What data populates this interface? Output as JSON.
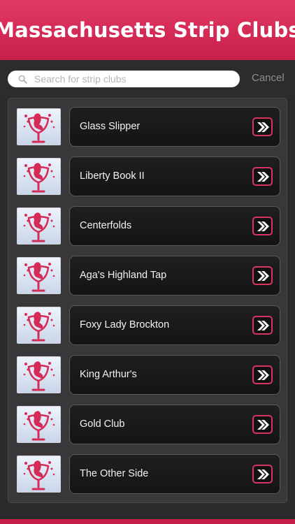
{
  "header": {
    "title": "Massachusetts Strip Clubs"
  },
  "search": {
    "placeholder": "Search for strip clubs",
    "value": "",
    "cancel_label": "Cancel"
  },
  "list": {
    "items": [
      {
        "label": "Glass Slipper"
      },
      {
        "label": "Liberty Book II"
      },
      {
        "label": "Centerfolds"
      },
      {
        "label": "Aga's Highland Tap"
      },
      {
        "label": "Foxy Lady Brockton"
      },
      {
        "label": "King Arthur's"
      },
      {
        "label": "Gold Club"
      },
      {
        "label": "The Other Side"
      }
    ]
  },
  "icons": {
    "thumbnail": "dancer-in-glass-icon",
    "row_action": "double-chevron-right-icon",
    "search": "search-icon"
  },
  "colors": {
    "brand": "#c81e4a",
    "brand_light": "#e23a64",
    "background": "#2b2b2d",
    "card": "#18181a",
    "thumb_bg": "#dde6f4"
  }
}
